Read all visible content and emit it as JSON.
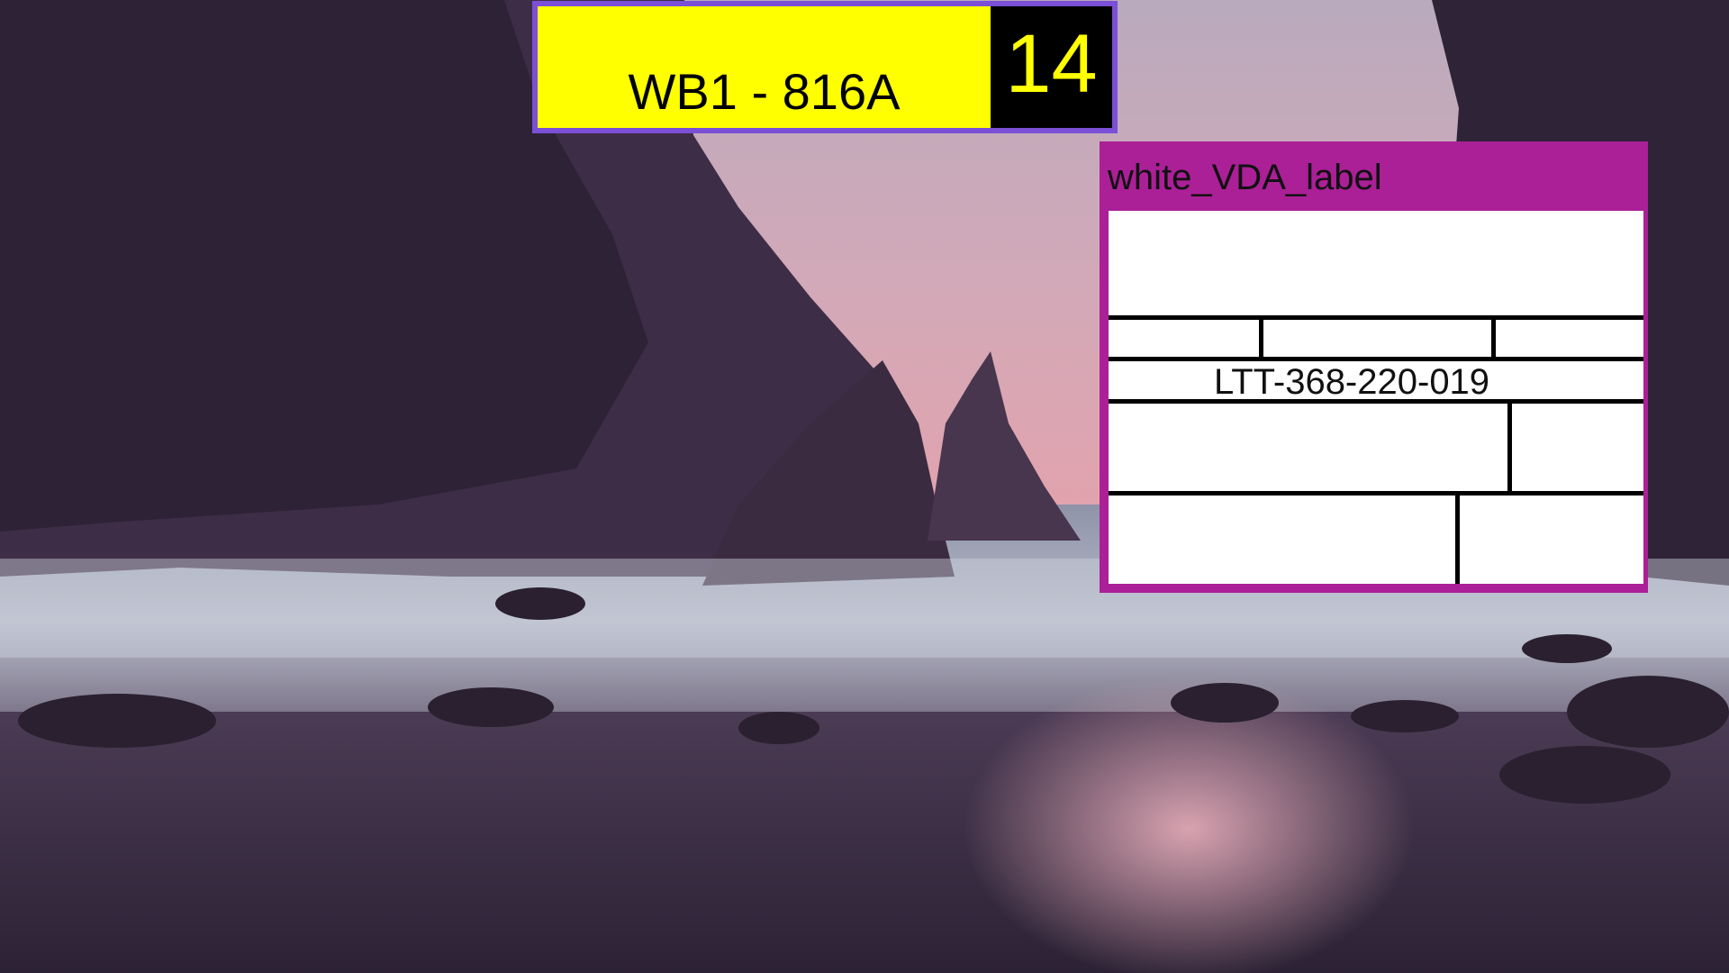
{
  "plate": {
    "text": "WB1 - 816A",
    "number": "14",
    "colors": {
      "text_bg": "#ffff00",
      "number_bg": "#000000",
      "border": "#7b4fd6"
    }
  },
  "label": {
    "title": "white_VDA_label",
    "code": "LTT-368-220-019",
    "colors": {
      "frame": "#ab1f97",
      "body": "#ffffff"
    }
  },
  "background": {
    "scene": "misty rocky beach at dusk with birds"
  }
}
